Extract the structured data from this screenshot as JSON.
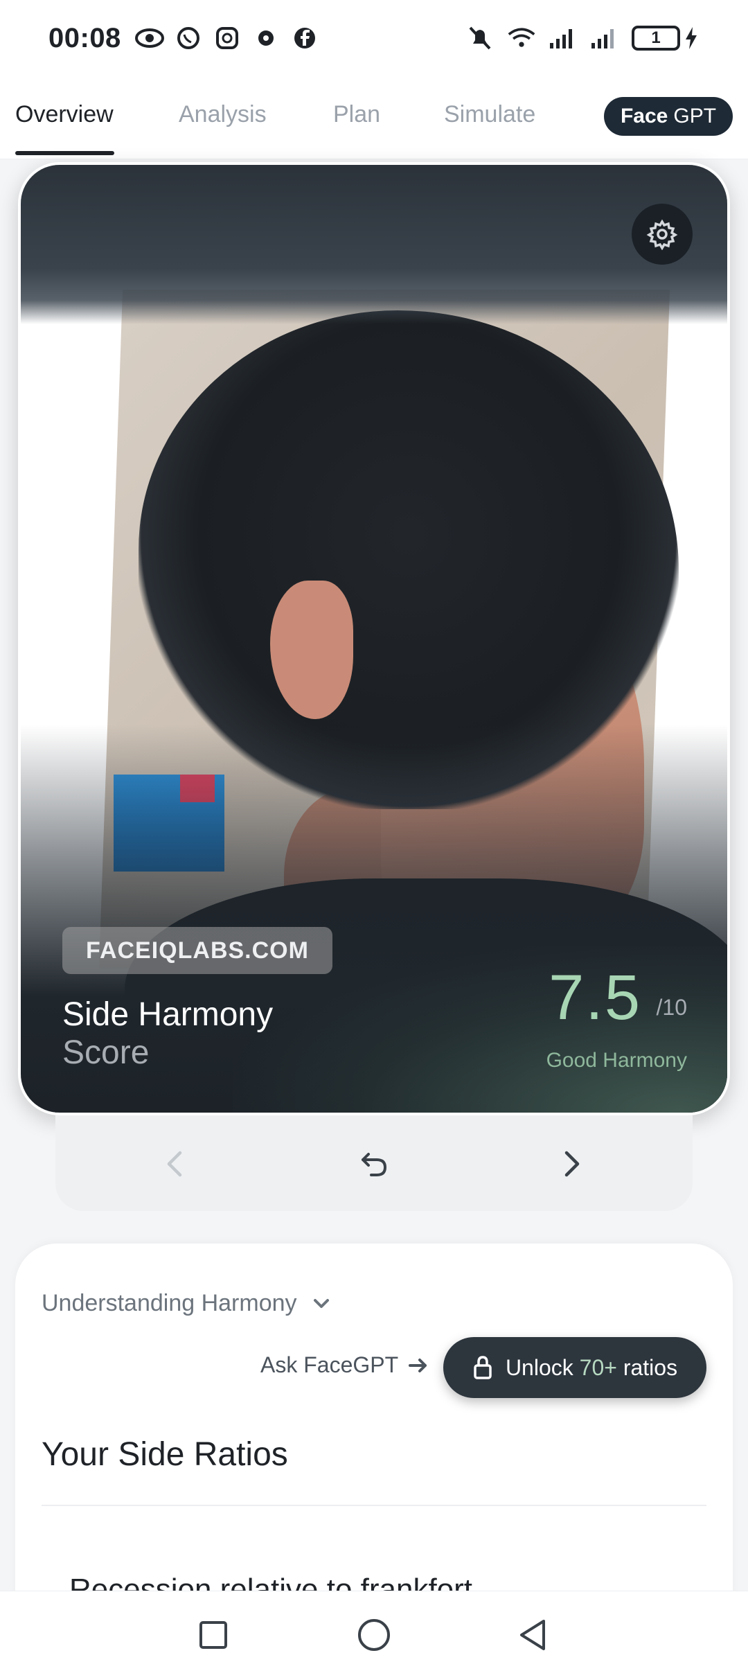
{
  "status_bar": {
    "time": "00:08",
    "left_icons": [
      "eye-icon",
      "whatsapp-icon",
      "instagram-icon",
      "gear-icon",
      "facebook-icon"
    ],
    "right_icons": [
      "bell-muted-icon",
      "wifi-icon",
      "signal-icon",
      "signal-icon",
      "battery-icon",
      "charging-icon"
    ],
    "battery_level": "1"
  },
  "tabs": {
    "items": [
      {
        "label": "Overview",
        "active": true
      },
      {
        "label": "Analysis",
        "active": false
      },
      {
        "label": "Plan",
        "active": false
      },
      {
        "label": "Simulate",
        "active": false
      }
    ],
    "facegpt": {
      "bold": "Face",
      "light": "GPT"
    }
  },
  "card": {
    "watermark": "FACEIQLABS.COM",
    "title": "Side Harmony",
    "subtitle": "Score",
    "score": "7.5",
    "score_max": "/10",
    "score_label": "Good Harmony",
    "settings_icon": "gear-icon"
  },
  "navigation": {
    "prev_icon": "chevron-left-icon",
    "reset_icon": "undo-icon",
    "next_icon": "chevron-right-icon"
  },
  "panel": {
    "understanding": "Understanding Harmony",
    "ask": "Ask FaceGPT",
    "unlock": {
      "prefix": "Unlock",
      "highlight": "70+",
      "suffix": "ratios"
    },
    "section_title": "Your Side Ratios",
    "first_item": "Recession relative to frankfort"
  },
  "system_nav": [
    "square-icon",
    "circle-icon",
    "triangle-back-icon"
  ],
  "colors": {
    "accent_dark": "#1e2a36",
    "score_green": "#a8d6b4",
    "button_dark": "#2d353d"
  }
}
